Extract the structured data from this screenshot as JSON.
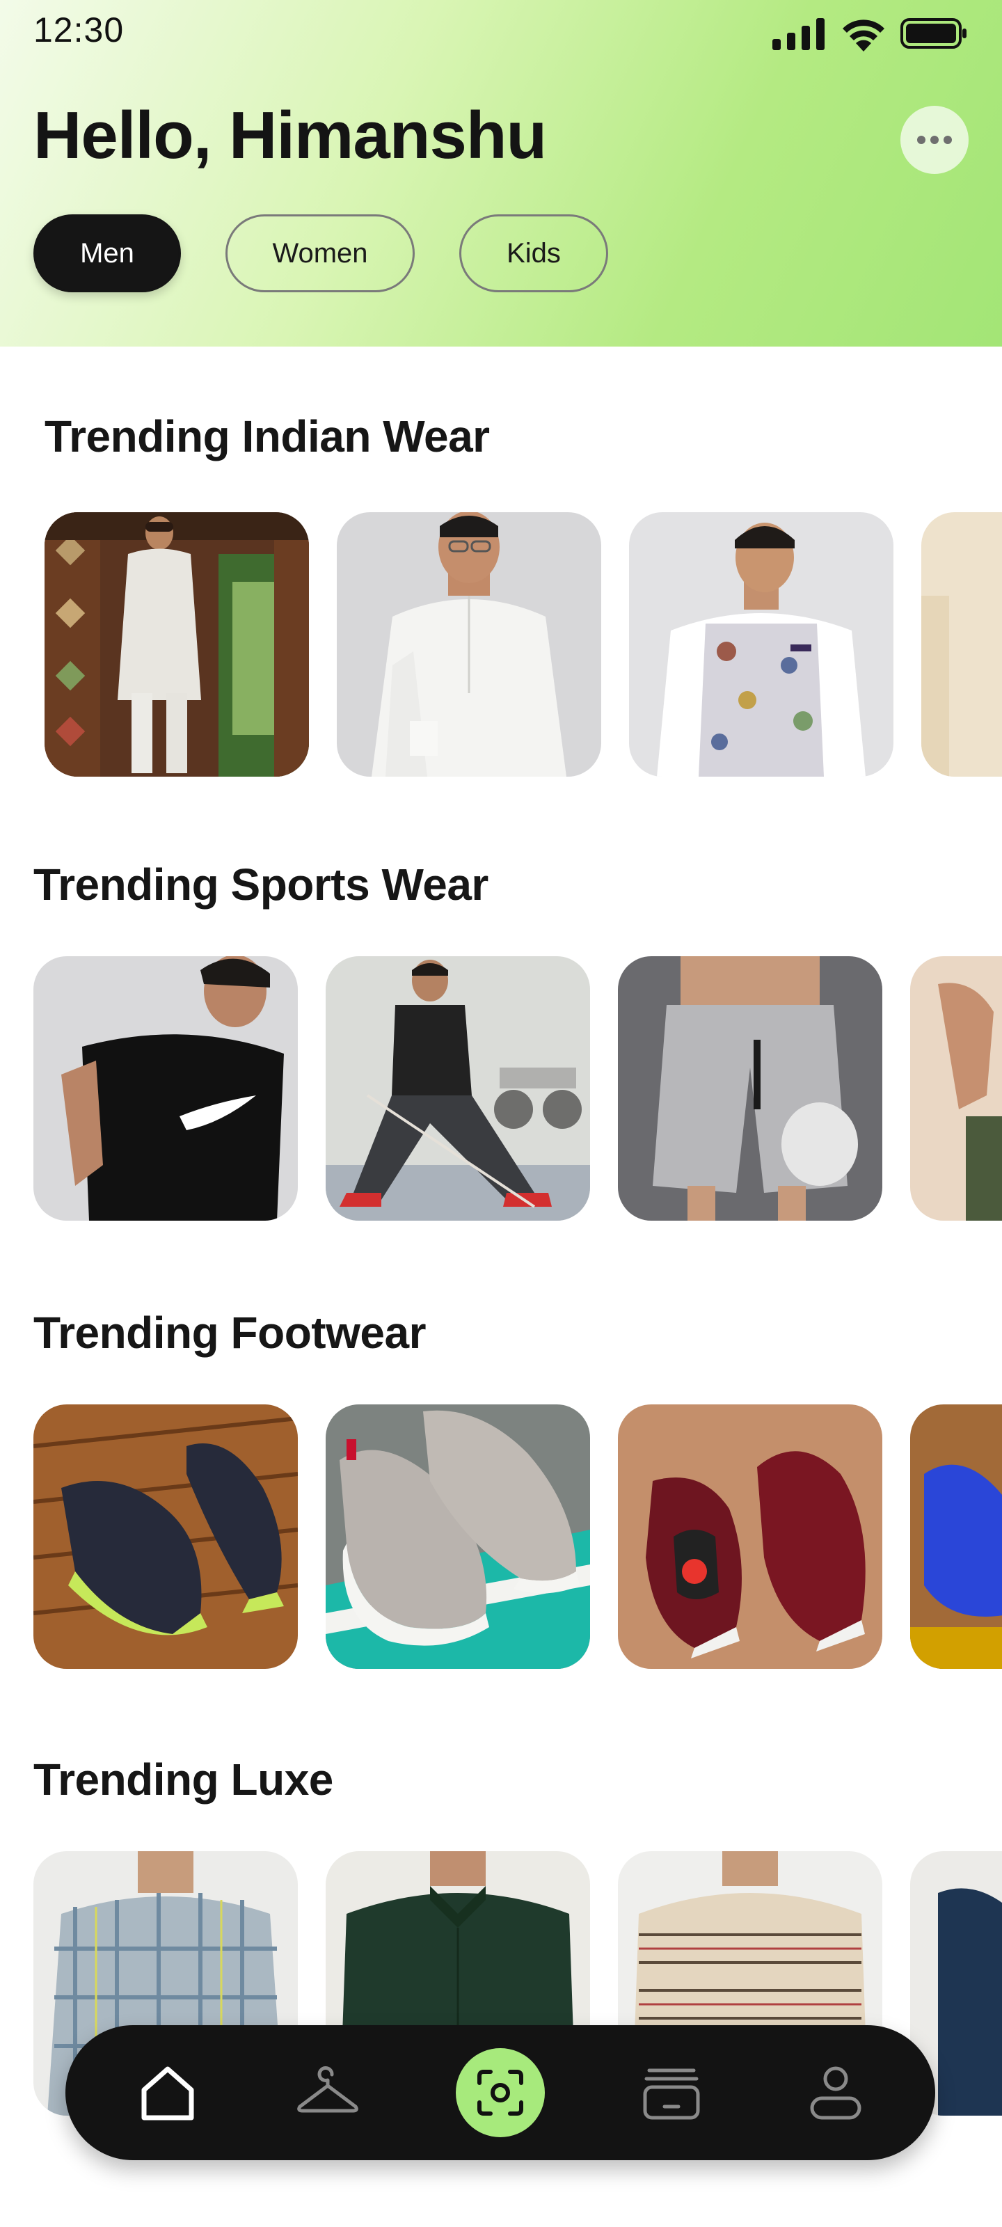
{
  "status_bar": {
    "time": "12:30"
  },
  "header": {
    "greeting": "Hello, Himanshu",
    "tabs": [
      {
        "label": "Men",
        "active": true
      },
      {
        "label": "Women",
        "active": false
      },
      {
        "label": "Kids",
        "active": false
      }
    ]
  },
  "sections": [
    {
      "title": "Trending Indian Wear"
    },
    {
      "title": "Trending Sports Wear"
    },
    {
      "title": "Trending Footwear"
    },
    {
      "title": "Trending Luxe"
    }
  ],
  "bottom_nav": {
    "items": [
      "home-icon",
      "hanger-icon",
      "scan-icon",
      "bag-icon",
      "profile-icon"
    ],
    "active": "home-icon"
  },
  "colors": {
    "accent": "#a7ea7c",
    "dark": "#131313",
    "header_gradient_start": "#f3fbe9",
    "header_gradient_end": "#a3e576"
  }
}
